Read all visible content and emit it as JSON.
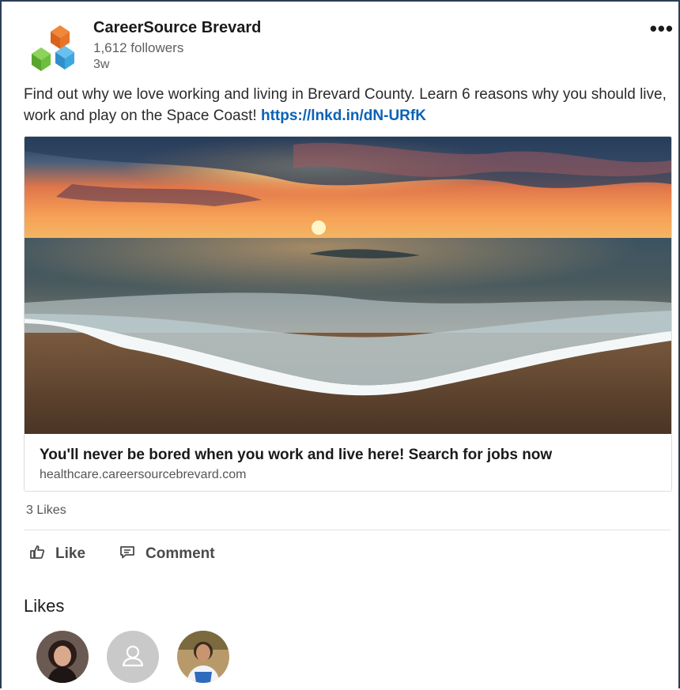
{
  "company": {
    "name": "CareerSource Brevard",
    "followers": "1,612 followers",
    "age": "3w",
    "logo_colors": [
      "#e8742a",
      "#3fa7e0",
      "#6bbf3c"
    ]
  },
  "menu": {
    "more_label": "•••"
  },
  "post": {
    "text": "Find out why we love working and living in Brevard County. Learn 6 reasons why you should live, work and play on the Space Coast! ",
    "link": "https://lnkd.in/dN-URfK"
  },
  "card": {
    "title": "You'll never be bored when you work and live here! Search for jobs now",
    "domain": "healthcare.careersourcebrevard.com"
  },
  "social": {
    "likes_count": "3 Likes"
  },
  "actions": {
    "like_label": "Like",
    "comment_label": "Comment"
  },
  "likes_section": {
    "heading": "Likes"
  },
  "colors": {
    "link": "#0b62b7",
    "frame_border": "#2b3d57"
  }
}
